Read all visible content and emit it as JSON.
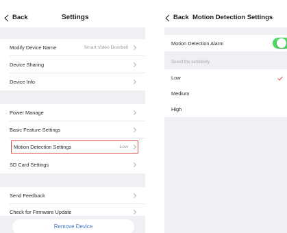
{
  "left_screen": {
    "back_label": "Back",
    "title": "Settings",
    "rows": [
      {
        "label": "Modify Device Name",
        "value": "Smart Video Doorbell"
      },
      {
        "label": "Device Sharing",
        "value": ""
      },
      {
        "label": "Device Info",
        "value": ""
      },
      {
        "label": "Power Manage",
        "value": ""
      },
      {
        "label": "Basic Feature Settings",
        "value": ""
      },
      {
        "label": "Motion Detection Settings",
        "value": "Low"
      },
      {
        "label": "SD Card Settings",
        "value": ""
      },
      {
        "label": "Send Feedback",
        "value": ""
      },
      {
        "label": "Check for Firmware Update",
        "value": ""
      }
    ],
    "remove_button": "Remove Device",
    "highlight_color": "#d84a4a"
  },
  "right_screen": {
    "back_label": "Back",
    "title": "Motion Detection Settings",
    "alarm_label": "Motion Detection Alarm",
    "alarm_enabled": true,
    "section_label": "Select the sensitivity",
    "options": [
      "Low",
      "Medium",
      "High"
    ],
    "selected_option": "Low",
    "toggle_color": "#4cd964",
    "check_color": "#d84a4a"
  }
}
